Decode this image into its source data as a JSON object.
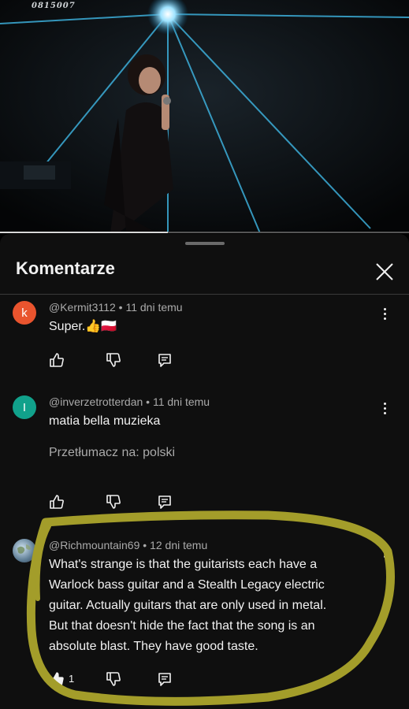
{
  "video": {
    "id_text": "0815007",
    "progress_percent": 41
  },
  "sheet": {
    "title": "Komentarze"
  },
  "comments": [
    {
      "avatar_letter": "k",
      "avatar_color": "#e9542e",
      "author": "@Kermit3112",
      "time": "11 dni temu",
      "text": "Super.👍🇵🇱",
      "like_count": ""
    },
    {
      "avatar_letter": "I",
      "avatar_color": "#11a18b",
      "author": "@inverzetrotterdan",
      "time": "11 dni temu",
      "text": "matia bella muzieka",
      "translate": "Przetłumacz na: polski",
      "like_count": ""
    },
    {
      "avatar_letter": "",
      "avatar_color": "#6b8aa3",
      "author": "@Richmountain69",
      "time": "12 dni temu",
      "text_lines": [
        "What's strange is that the guitarists each have a",
        "Warlock bass guitar and a Stealth Legacy electric",
        "guitar. Actually guitars that are only used in metal.",
        "But that doesn't hide the fact that the song is an",
        "absolute blast. They have good taste."
      ],
      "like_count": "1"
    }
  ],
  "colors": {
    "highlight": "#a39d2a",
    "background": "#0f0f0f",
    "meta": "#aaaaaa"
  },
  "icons": [
    "like-icon",
    "dislike-icon",
    "reply-icon",
    "more-vert-icon",
    "close-icon"
  ]
}
